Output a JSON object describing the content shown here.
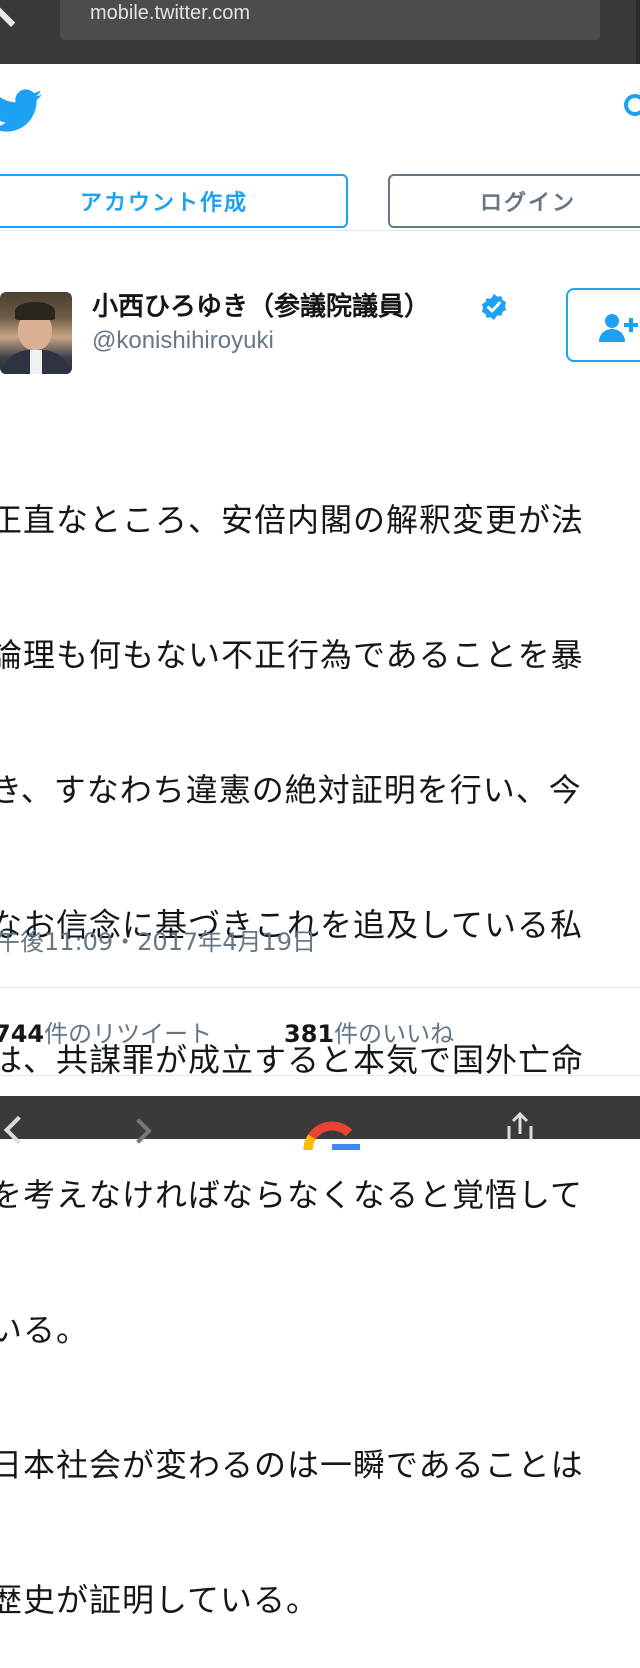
{
  "browser": {
    "url": "mobile.twitter.com"
  },
  "header": {
    "signup_label": "アカウント作成",
    "login_label": "ログイン"
  },
  "tweet": {
    "author_name": "小西ひろゆき（参議院議員）",
    "author_handle": "@konishihiroyuki",
    "text_lines": [
      "正直なところ、安倍内閣の解釈変更が法",
      "論理も何もない不正行為であることを暴",
      "き、すなわち違憲の絶対証明を行い、今",
      "なお信念に基づきこれを追及している私",
      "は、共謀罪が成立すると本気で国外亡命",
      "を考えなければならなくなると覚悟して",
      "いる。",
      "日本社会が変わるのは一瞬であることは",
      "歴史が証明している。"
    ],
    "timestamp": "午後11:09・2017年4月19日",
    "retweets": {
      "count": "744",
      "label": "件のリツイート"
    },
    "likes": {
      "count": "381",
      "label": "件のいいね"
    }
  },
  "colors": {
    "brand": "#1da1f2",
    "secondary_text": "#657786",
    "chrome": "#3a3a3a"
  },
  "icons": [
    "back-icon",
    "twitter-bird-icon",
    "search-icon",
    "verified-badge-icon",
    "follow-user-icon",
    "forward-icon",
    "google-icon",
    "share-icon"
  ]
}
